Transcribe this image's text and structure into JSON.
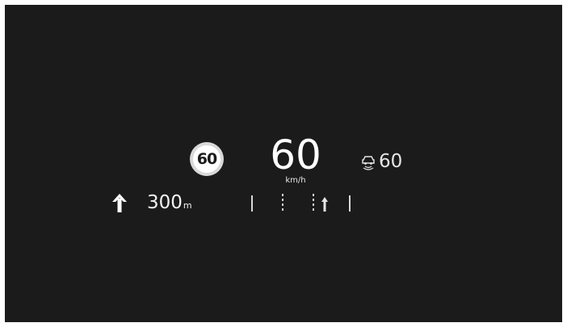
{
  "hud": {
    "speed_limit": "60",
    "current_speed": "60",
    "speed_unit": "km/h",
    "cruise": {
      "icon": "adaptive-cruise-icon",
      "set_speed": "60"
    },
    "navigation": {
      "icon": "arrow-up-icon",
      "distance": "300",
      "distance_unit": "m"
    },
    "lane_guidance": {
      "icon": "lane-guidance-icon"
    }
  },
  "colors": {
    "background": "#1b1b1b",
    "text": "#f2f2f2",
    "limit_sign_ring": "#d9d9d9",
    "limit_sign_face": "#ffffff"
  }
}
